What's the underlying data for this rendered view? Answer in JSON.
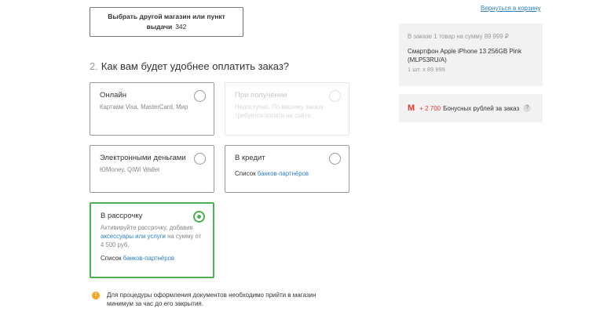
{
  "store_button": {
    "label": "Выбрать другой магазин или пункт выдачи",
    "count": "342"
  },
  "section": {
    "number": "2.",
    "title": "Как вам будет удобнее оплатить заказ?"
  },
  "payment_options": {
    "online": {
      "title": "Онлайн",
      "desc": "Картами Visa, MasterCard, Мир"
    },
    "on_receipt": {
      "title": "При получении",
      "desc": "Недоступно. По вашему заказу требуется оплата на сайте."
    },
    "emoney": {
      "title": "Электронными деньгами",
      "desc": "ЮMoney, QIWI Wallet"
    },
    "credit": {
      "title": "В кредит",
      "list_prefix": "Список",
      "list_link": "банков-партнёров"
    },
    "installment": {
      "title": "В рассрочку",
      "desc_1": "Активируйте рассрочку, добавив",
      "desc_link": "аксессуары или услуги",
      "desc_2": "на сумму от 4 500 руб.",
      "list_prefix": "Список",
      "list_link": "банков-партнёров"
    }
  },
  "notice": {
    "text": "Для процедуры оформления документов необходимо прийти в магазин минимум за час до его закрытия."
  },
  "sidebar": {
    "back_link": "Вернуться в корзину",
    "summary_head": "В заказе 1 товар на сумму 89 999 ₽",
    "product": "Смартфон Apple iPhone 13 256GB Pink (MLP53RU/A)",
    "qty": "1 шт. x 89 999",
    "bonus_amount": "+ 2 700",
    "bonus_text": "Бонусных рублей за заказ"
  },
  "colors": {
    "accent_green": "#4caf50",
    "link_blue": "#2f80c3",
    "bonus_red": "#e5372c"
  }
}
